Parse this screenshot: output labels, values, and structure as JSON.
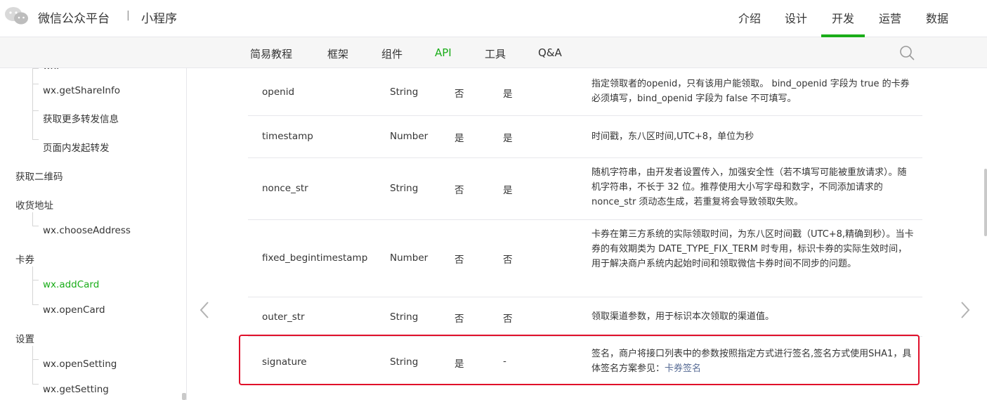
{
  "header": {
    "brand": "微信公众平台",
    "separator": "|",
    "product": "小程序",
    "nav": [
      "介绍",
      "设计",
      "开发",
      "运营",
      "数据"
    ],
    "active_nav": "开发",
    "accent_color": "#1aad19"
  },
  "subnav": {
    "items": [
      "简易教程",
      "框架",
      "组件",
      "API",
      "工具",
      "Q&A"
    ],
    "active": "API"
  },
  "sidebar": {
    "items": [
      {
        "label": "wx.getShareInfo",
        "type": "child"
      },
      {
        "label": "获取更多转发信息",
        "type": "child"
      },
      {
        "label": "页面内发起转发",
        "type": "child"
      },
      {
        "label": "获取二维码",
        "type": "group"
      },
      {
        "label": "收货地址",
        "type": "group"
      },
      {
        "label": "wx.chooseAddress",
        "type": "child"
      },
      {
        "label": "卡券",
        "type": "group"
      },
      {
        "label": "wx.addCard",
        "type": "child",
        "active": true
      },
      {
        "label": "wx.openCard",
        "type": "child"
      },
      {
        "label": "设置",
        "type": "group"
      },
      {
        "label": "wx.openSetting",
        "type": "child"
      },
      {
        "label": "wx.getSetting",
        "type": "child"
      }
    ]
  },
  "table": {
    "rows": [
      {
        "name": "openid",
        "type": "String",
        "required": "否",
        "in_signature": "是",
        "desc": "指定领取者的openid，只有该用户能领取。 bind_openid 字段为 true 的卡券必须填写，bind_openid 字段为 false 不可填写。"
      },
      {
        "name": "timestamp",
        "type": "Number",
        "required": "是",
        "in_signature": "是",
        "desc": "时间戳，东八区时间,UTC+8，单位为秒"
      },
      {
        "name": "nonce_str",
        "type": "String",
        "required": "否",
        "in_signature": "是",
        "desc": "随机字符串，由开发者设置传入，加强安全性（若不填写可能被重放请求）。随机字符串，不长于 32 位。推荐使用大小写字母和数字，不同添加请求的 nonce_str 须动态生成，若重复将会导致领取失败。"
      },
      {
        "name": "fixed_begintimestamp",
        "type": "Number",
        "required": "否",
        "in_signature": "否",
        "desc": "卡券在第三方系统的实际领取时间，为东八区时间戳（UTC+8,精确到秒）。当卡券的有效期类为 DATE_TYPE_FIX_TERM 时专用，标识卡券的实际生效时间，用于解决商户系统内起始时间和领取微信卡券时间不同步的问题。"
      },
      {
        "name": "outer_str",
        "type": "String",
        "required": "否",
        "in_signature": "否",
        "desc": "领取渠道参数，用于标识本次领取的渠道值。"
      },
      {
        "name": "signature",
        "type": "String",
        "required": "是",
        "in_signature": "-",
        "desc": "签名，商户将接口列表中的参数按照指定方式进行签名,签名方式使用SHA1，具体签名方案参见：",
        "link": "卡券签名"
      }
    ]
  }
}
